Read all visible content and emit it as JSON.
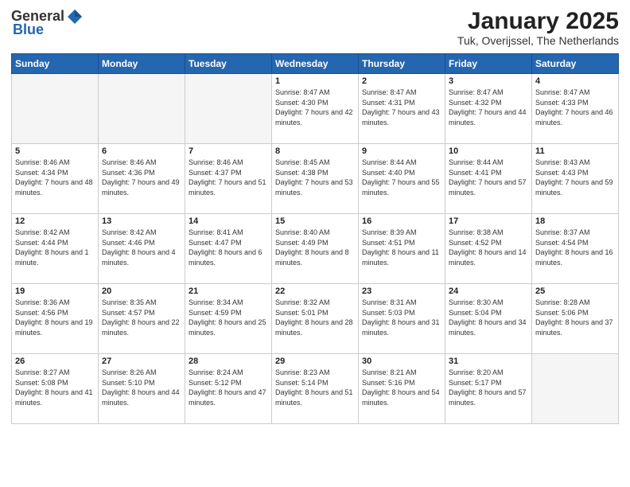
{
  "header": {
    "logo_general": "General",
    "logo_blue": "Blue",
    "month_title": "January 2025",
    "location": "Tuk, Overijssel, The Netherlands"
  },
  "days_of_week": [
    "Sunday",
    "Monday",
    "Tuesday",
    "Wednesday",
    "Thursday",
    "Friday",
    "Saturday"
  ],
  "weeks": [
    [
      {
        "day": "",
        "empty": true
      },
      {
        "day": "",
        "empty": true
      },
      {
        "day": "",
        "empty": true
      },
      {
        "day": "1",
        "sunrise": "8:47 AM",
        "sunset": "4:30 PM",
        "daylight": "7 hours and 42 minutes."
      },
      {
        "day": "2",
        "sunrise": "8:47 AM",
        "sunset": "4:31 PM",
        "daylight": "7 hours and 43 minutes."
      },
      {
        "day": "3",
        "sunrise": "8:47 AM",
        "sunset": "4:32 PM",
        "daylight": "7 hours and 44 minutes."
      },
      {
        "day": "4",
        "sunrise": "8:47 AM",
        "sunset": "4:33 PM",
        "daylight": "7 hours and 46 minutes."
      }
    ],
    [
      {
        "day": "5",
        "sunrise": "8:46 AM",
        "sunset": "4:34 PM",
        "daylight": "7 hours and 48 minutes."
      },
      {
        "day": "6",
        "sunrise": "8:46 AM",
        "sunset": "4:36 PM",
        "daylight": "7 hours and 49 minutes."
      },
      {
        "day": "7",
        "sunrise": "8:46 AM",
        "sunset": "4:37 PM",
        "daylight": "7 hours and 51 minutes."
      },
      {
        "day": "8",
        "sunrise": "8:45 AM",
        "sunset": "4:38 PM",
        "daylight": "7 hours and 53 minutes."
      },
      {
        "day": "9",
        "sunrise": "8:44 AM",
        "sunset": "4:40 PM",
        "daylight": "7 hours and 55 minutes."
      },
      {
        "day": "10",
        "sunrise": "8:44 AM",
        "sunset": "4:41 PM",
        "daylight": "7 hours and 57 minutes."
      },
      {
        "day": "11",
        "sunrise": "8:43 AM",
        "sunset": "4:43 PM",
        "daylight": "7 hours and 59 minutes."
      }
    ],
    [
      {
        "day": "12",
        "sunrise": "8:42 AM",
        "sunset": "4:44 PM",
        "daylight": "8 hours and 1 minute."
      },
      {
        "day": "13",
        "sunrise": "8:42 AM",
        "sunset": "4:46 PM",
        "daylight": "8 hours and 4 minutes."
      },
      {
        "day": "14",
        "sunrise": "8:41 AM",
        "sunset": "4:47 PM",
        "daylight": "8 hours and 6 minutes."
      },
      {
        "day": "15",
        "sunrise": "8:40 AM",
        "sunset": "4:49 PM",
        "daylight": "8 hours and 8 minutes."
      },
      {
        "day": "16",
        "sunrise": "8:39 AM",
        "sunset": "4:51 PM",
        "daylight": "8 hours and 11 minutes."
      },
      {
        "day": "17",
        "sunrise": "8:38 AM",
        "sunset": "4:52 PM",
        "daylight": "8 hours and 14 minutes."
      },
      {
        "day": "18",
        "sunrise": "8:37 AM",
        "sunset": "4:54 PM",
        "daylight": "8 hours and 16 minutes."
      }
    ],
    [
      {
        "day": "19",
        "sunrise": "8:36 AM",
        "sunset": "4:56 PM",
        "daylight": "8 hours and 19 minutes."
      },
      {
        "day": "20",
        "sunrise": "8:35 AM",
        "sunset": "4:57 PM",
        "daylight": "8 hours and 22 minutes."
      },
      {
        "day": "21",
        "sunrise": "8:34 AM",
        "sunset": "4:59 PM",
        "daylight": "8 hours and 25 minutes."
      },
      {
        "day": "22",
        "sunrise": "8:32 AM",
        "sunset": "5:01 PM",
        "daylight": "8 hours and 28 minutes."
      },
      {
        "day": "23",
        "sunrise": "8:31 AM",
        "sunset": "5:03 PM",
        "daylight": "8 hours and 31 minutes."
      },
      {
        "day": "24",
        "sunrise": "8:30 AM",
        "sunset": "5:04 PM",
        "daylight": "8 hours and 34 minutes."
      },
      {
        "day": "25",
        "sunrise": "8:28 AM",
        "sunset": "5:06 PM",
        "daylight": "8 hours and 37 minutes."
      }
    ],
    [
      {
        "day": "26",
        "sunrise": "8:27 AM",
        "sunset": "5:08 PM",
        "daylight": "8 hours and 41 minutes."
      },
      {
        "day": "27",
        "sunrise": "8:26 AM",
        "sunset": "5:10 PM",
        "daylight": "8 hours and 44 minutes."
      },
      {
        "day": "28",
        "sunrise": "8:24 AM",
        "sunset": "5:12 PM",
        "daylight": "8 hours and 47 minutes."
      },
      {
        "day": "29",
        "sunrise": "8:23 AM",
        "sunset": "5:14 PM",
        "daylight": "8 hours and 51 minutes."
      },
      {
        "day": "30",
        "sunrise": "8:21 AM",
        "sunset": "5:16 PM",
        "daylight": "8 hours and 54 minutes."
      },
      {
        "day": "31",
        "sunrise": "8:20 AM",
        "sunset": "5:17 PM",
        "daylight": "8 hours and 57 minutes."
      },
      {
        "day": "",
        "empty": true
      }
    ]
  ]
}
